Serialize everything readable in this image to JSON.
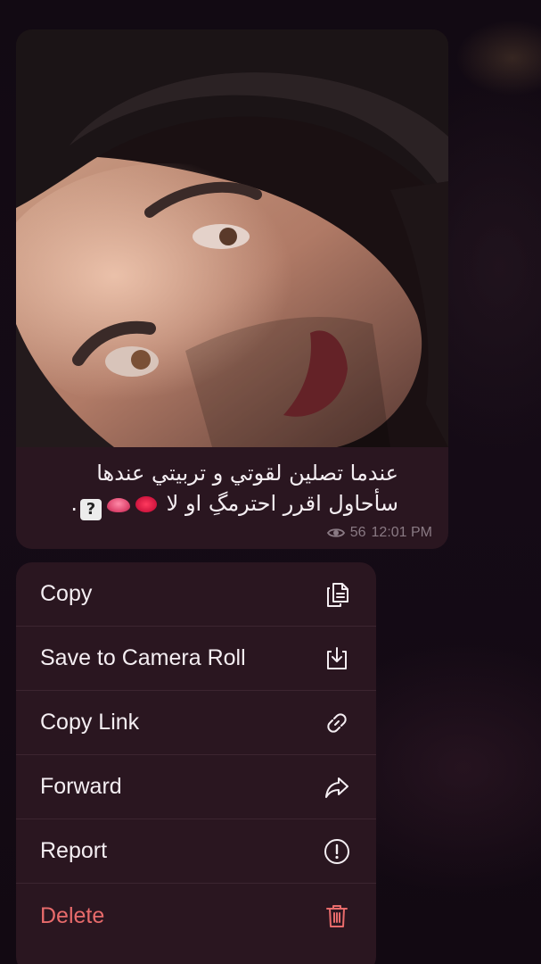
{
  "message": {
    "caption_line1": "عندما تصلين لقوتي و تربيتي  عندها",
    "caption_line2": "سأحاول اقرر احترمگِ او لا",
    "caption_line2_end": ".",
    "views": "56",
    "time": "12:01 PM"
  },
  "menu": {
    "items": [
      {
        "label": "Copy",
        "icon": "copy-icon"
      },
      {
        "label": "Save to Camera Roll",
        "icon": "download-icon"
      },
      {
        "label": "Copy Link",
        "icon": "link-icon"
      },
      {
        "label": "Forward",
        "icon": "forward-arrow-icon"
      },
      {
        "label": "Report",
        "icon": "exclamation-circle-icon"
      },
      {
        "label": "Delete",
        "icon": "trash-icon"
      }
    ]
  },
  "colors": {
    "background": "#110a12",
    "bubble": "#2a1620",
    "text": "#f4eef2",
    "meta": "#8a7a84",
    "danger": "#e86b6b"
  }
}
